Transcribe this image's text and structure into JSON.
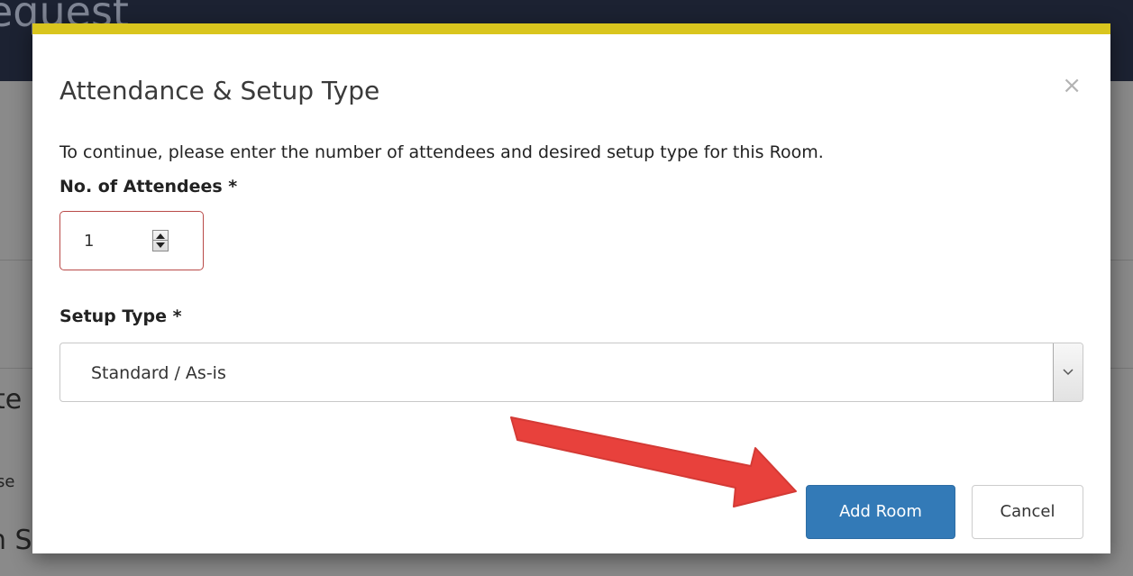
{
  "background": {
    "header_title": "equest",
    "fragments": [
      "te",
      "se",
      "n S"
    ]
  },
  "modal": {
    "title": "Attendance & Setup Type",
    "close_glyph": "×",
    "intro": "To continue, please enter the number of attendees and desired setup type for this Room.",
    "attendees_label": "No. of Attendees *",
    "attendees_value": "1",
    "setup_label": "Setup Type *",
    "setup_value": "Standard / As-is",
    "add_button": "Add Room",
    "cancel_button": "Cancel"
  },
  "colors": {
    "accent_bar": "#d9c51e",
    "primary_button": "#337ab7",
    "error_border": "#b94a48",
    "annotation_arrow": "#e8413c"
  },
  "icons": {
    "close": "close-icon",
    "spinner": "spinner-icon",
    "dropdown": "chevron-down-icon",
    "annotation": "red-arrow-icon"
  }
}
